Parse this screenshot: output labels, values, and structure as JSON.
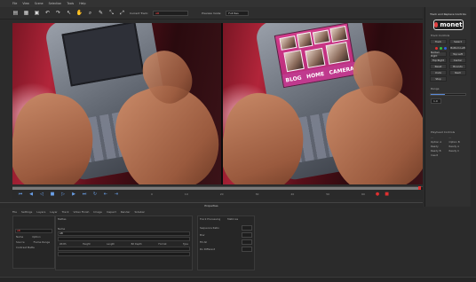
{
  "menu": [
    "File",
    "View",
    "Scene",
    "Selection",
    "Tools",
    "Help"
  ],
  "toolbar": {
    "layer_label": "Current Track:",
    "layer_value": "AB",
    "preview_label": "Preview mode:",
    "preview_value": "Full Res"
  },
  "viewer": {
    "collage_items": [
      "BLOG",
      "HOME",
      "CAMERA"
    ]
  },
  "timeline": {
    "frame_markers": [
      "0",
      "10",
      "20",
      "30",
      "40",
      "50",
      "60"
    ]
  },
  "sidebar": {
    "title": "Track and Replace Controls",
    "logo": "monet",
    "tools_label": "Track Controls",
    "tool_buttons": [
      "Track",
      "Select",
      "Bottom Left",
      "Bottom Right",
      "Top Left",
      "Top Right",
      "Center",
      "Reset",
      "Bounds",
      "Undo",
      "Next",
      "Stop"
    ],
    "range_label": "Range",
    "range_value": "1.0",
    "playhead_label": "Playhead Controls",
    "playhead_buttons": [
      "...",
      "...",
      "Option A",
      "Option B",
      "Ready",
      "Ready A",
      "Ready B",
      "Ready C",
      "Insert"
    ]
  },
  "properties": {
    "title": "Properties",
    "tabs": [
      "File",
      "Settings",
      "Layers",
      "Layer",
      "Track",
      "Video Finish",
      "Image",
      "Inspect",
      "Render",
      "Sidebar"
    ],
    "right_tabs": [
      "Mattebook",
      "Colorspace",
      "Time"
    ],
    "left": {
      "rows": [
        "Name",
        "Option",
        "Source",
        "Frame Range",
        "Contrast Matte"
      ],
      "value": "AB"
    },
    "middle": {
      "label": "Mattes",
      "name_label": "Name",
      "name_value": "AB",
      "columns": [
        "Width",
        "Height",
        "Length",
        "Bit Depth",
        "Format",
        "Type"
      ]
    },
    "right": {
      "header": "Track Processing",
      "subheader": "Matrices",
      "rows": [
        "Sequence Ratio",
        "Blur",
        "Fill All",
        "Do Different"
      ]
    }
  }
}
